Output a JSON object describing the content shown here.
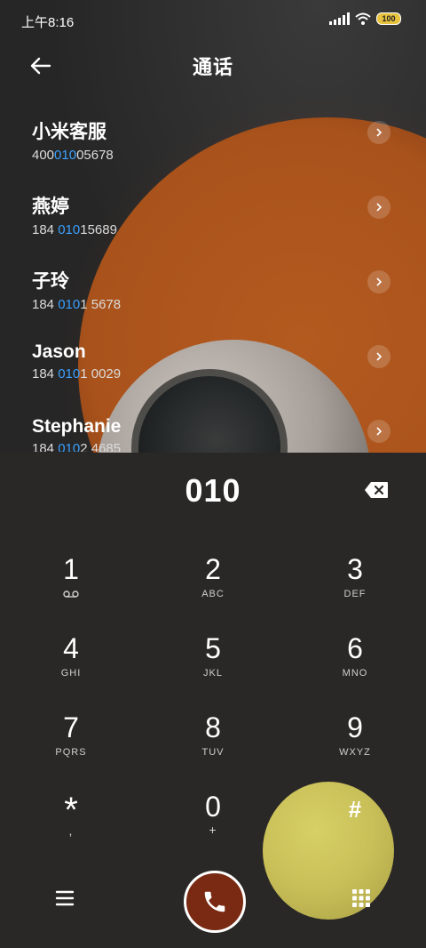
{
  "status": {
    "time": "上午8:16",
    "battery": "100"
  },
  "header": {
    "title": "通话"
  },
  "contacts": [
    {
      "name": "小米客服",
      "num_pre": "400",
      "num_hl": "010",
      "num_post": "05678"
    },
    {
      "name": "燕婷",
      "num_pre": "184 ",
      "num_hl": "010",
      "num_post": "15689"
    },
    {
      "name": "子玲",
      "num_pre": "184 ",
      "num_hl": "010",
      "num_post": "1 5678"
    },
    {
      "name": "Jason",
      "num_pre": "184 ",
      "num_hl": "010",
      "num_post": "1 0029"
    },
    {
      "name": "Stephanie",
      "num_pre": "184 ",
      "num_hl": "010",
      "num_post": "2 4685"
    }
  ],
  "dialer": {
    "entered": "010"
  },
  "keys": [
    {
      "digit": "1",
      "letters": ""
    },
    {
      "digit": "2",
      "letters": "ABC"
    },
    {
      "digit": "3",
      "letters": "DEF"
    },
    {
      "digit": "4",
      "letters": "GHI"
    },
    {
      "digit": "5",
      "letters": "JKL"
    },
    {
      "digit": "6",
      "letters": "MNO"
    },
    {
      "digit": "7",
      "letters": "PQRS"
    },
    {
      "digit": "8",
      "letters": "TUV"
    },
    {
      "digit": "9",
      "letters": "WXYZ"
    },
    {
      "digit": "*",
      "letters": ","
    },
    {
      "digit": "0",
      "letters": "+"
    },
    {
      "digit": "#",
      "letters": ""
    }
  ],
  "icons": {
    "back": "arrow-left-icon",
    "delete": "backspace-icon",
    "voicemail": "voicemail-icon",
    "menu": "menu-icon",
    "call": "phone-icon",
    "dialpad": "dialpad-icon"
  }
}
